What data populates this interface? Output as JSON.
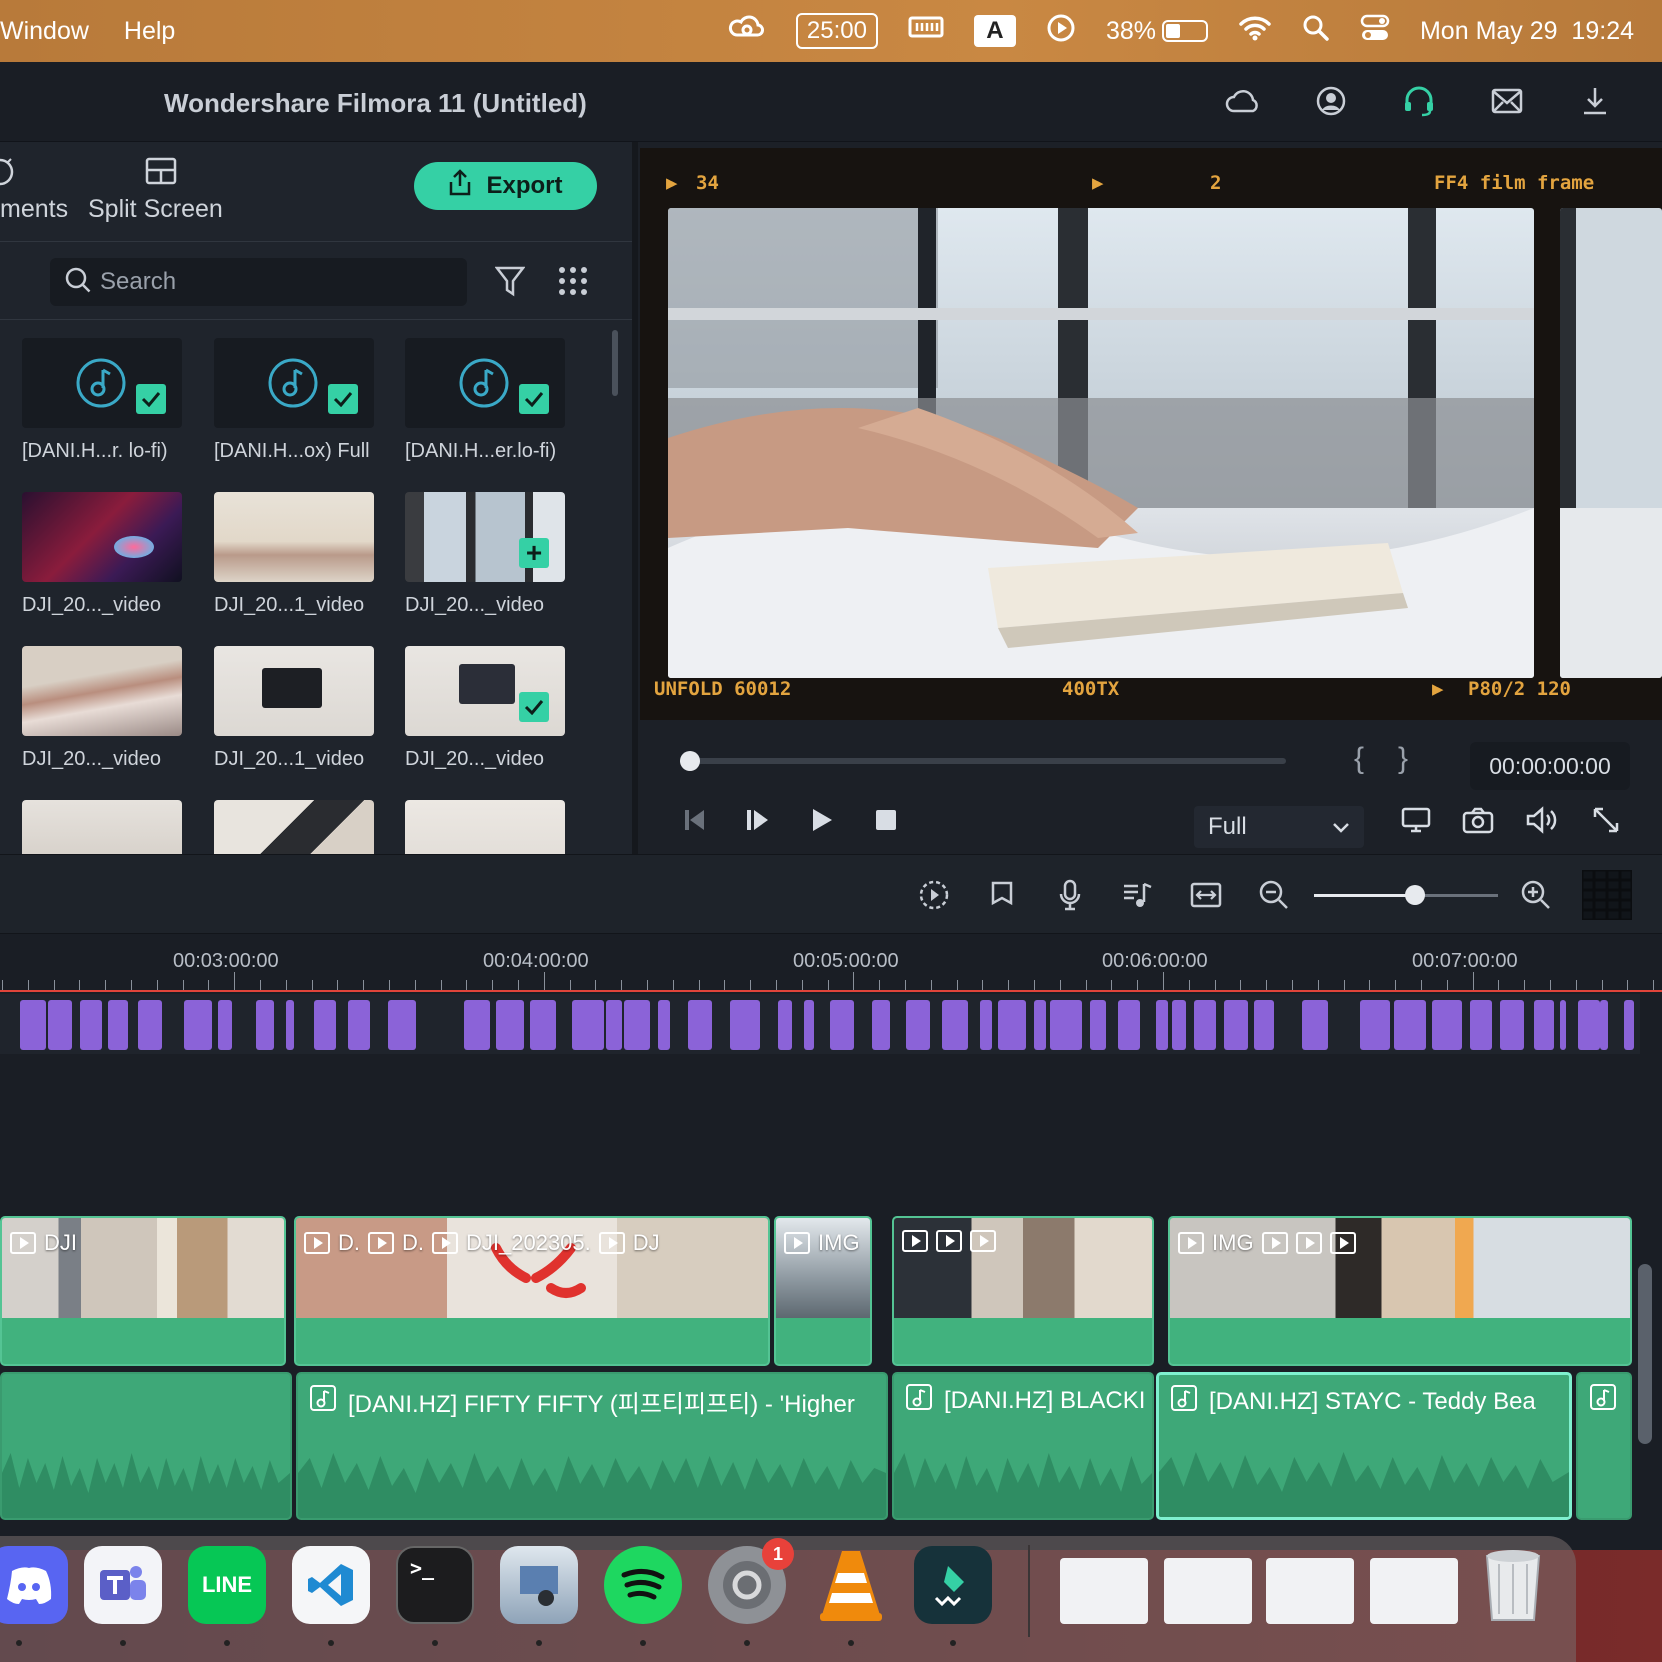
{
  "menubar": {
    "items": [
      "Window",
      "Help"
    ],
    "timer": "25:00",
    "input_source": "A",
    "battery_pct": "38%",
    "battery_level": 0.38,
    "datetime": "Mon May 29  19:24"
  },
  "app": {
    "title": "Wondershare Filmora 11 (Untitled)"
  },
  "left_panel": {
    "tabs": [
      "ments",
      "Split Screen"
    ],
    "export_label": "Export",
    "search_placeholder": "Search",
    "media": [
      {
        "label": "[DANI.H...r. lo-fi)",
        "kind": "audio",
        "checked": true
      },
      {
        "label": "[DANI.H...ox) Full",
        "kind": "audio",
        "checked": true
      },
      {
        "label": "[DANI.H...er.lo-fi)",
        "kind": "audio",
        "checked": true
      },
      {
        "label": "DJI_20..._video",
        "kind": "video",
        "checked": false
      },
      {
        "label": "DJI_20...1_video",
        "kind": "video",
        "checked": false
      },
      {
        "label": "DJI_20..._video",
        "kind": "video",
        "added": true
      },
      {
        "label": "DJI_20..._video",
        "kind": "video",
        "checked": false
      },
      {
        "label": "DJI_20...1_video",
        "kind": "video",
        "checked": false
      },
      {
        "label": "DJI_20..._video",
        "kind": "video",
        "checked": true
      }
    ]
  },
  "preview": {
    "film_top_left": "34",
    "film_top_mid": "2",
    "film_top_right": "FF4 film frame",
    "film_bot_left": "UNFOLD 60012",
    "film_bot_mid": "400TX",
    "film_bot_right": "P80/2 120",
    "timecode": "00:00:00:00",
    "quality": "Full",
    "brace_open": "{",
    "brace_close": "}",
    "progress": 0.0
  },
  "timeline": {
    "ruler": [
      "00:03:00:00",
      "00:04:00:00",
      "00:05:00:00",
      "00:06:00:00",
      "00:07:00:00"
    ],
    "video_clip_names": [
      "DJI",
      "D.",
      "D.",
      "DJI_202305.",
      "DJ",
      "IMG",
      "IMG"
    ],
    "audio_clips": [
      "[DANI.HZ] FIFTY FIFTY (피프티피프티) - 'Higher",
      "[DANI.HZ] BLACKI",
      "[DANI.HZ] STAYC - Teddy Bea"
    ],
    "zoom_level": 0.55
  },
  "dock": {
    "apps": [
      "discord",
      "teams",
      "line",
      "vscode",
      "terminal",
      "preview",
      "spotify",
      "system-settings",
      "vlc",
      "filmora"
    ],
    "line_label": "LINE",
    "settings_badge": "1",
    "terminal_prompt": ">_"
  },
  "colors": {
    "accent": "#35d0a5",
    "beat_marker": "#8b63d8",
    "video_clip": "#41b27e",
    "audio_clip": "#3ea878",
    "playhead": "#e0443a"
  }
}
